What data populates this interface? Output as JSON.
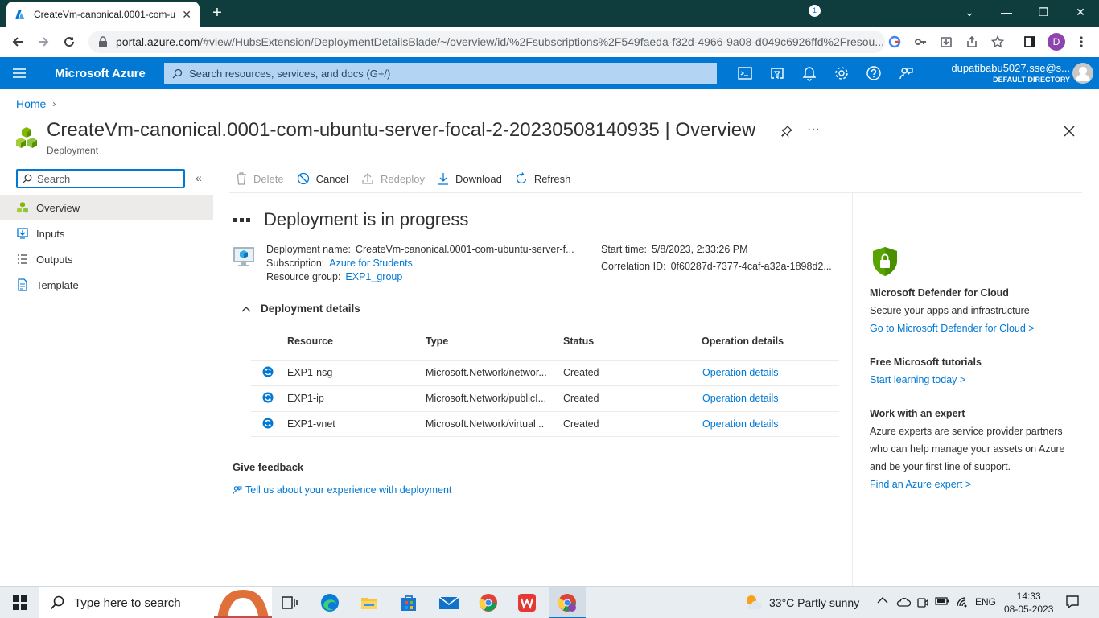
{
  "browser": {
    "tab_title": "CreateVm-canonical.0001-com-u",
    "new_tab": "+",
    "url_host": "portal.azure.com",
    "url_path": "/#view/HubsExtension/DeploymentDetailsBlade/~/overview/id/%2Fsubscriptions%2F549faeda-f32d-4966-9a08-d049c6926ffd%2Fresou...",
    "profile_initial": "D"
  },
  "azure": {
    "brand": "Microsoft Azure",
    "search_placeholder": "Search resources, services, and docs (G+/)",
    "notification_count": "1",
    "account_user": "dupatibabu5027.sse@s...",
    "account_directory": "DEFAULT DIRECTORY"
  },
  "breadcrumb": {
    "home": "Home"
  },
  "blade": {
    "title": "CreateVm-canonical.0001-com-ubuntu-server-focal-2-20230508140935",
    "title_suffix": " | Overview",
    "subtitle": "Deployment"
  },
  "menu": {
    "search_placeholder": "Search",
    "items": [
      {
        "label": "Overview"
      },
      {
        "label": "Inputs"
      },
      {
        "label": "Outputs"
      },
      {
        "label": "Template"
      }
    ]
  },
  "commands": {
    "delete": "Delete",
    "cancel": "Cancel",
    "redeploy": "Redeploy",
    "download": "Download",
    "refresh": "Refresh"
  },
  "status": {
    "title": "Deployment is in progress"
  },
  "info": {
    "deployment_name_label": "Deployment name:",
    "deployment_name": "CreateVm-canonical.0001-com-ubuntu-server-f...",
    "subscription_label": "Subscription:",
    "subscription": "Azure for Students",
    "resource_group_label": "Resource group:",
    "resource_group": "EXP1_group",
    "start_time_label": "Start time:",
    "start_time": "5/8/2023, 2:33:26 PM",
    "correlation_label": "Correlation ID:",
    "correlation_id": "0f60287d-7377-4caf-a32a-1898d2..."
  },
  "details": {
    "heading": "Deployment details",
    "columns": [
      "Resource",
      "Type",
      "Status",
      "Operation details"
    ],
    "rows": [
      {
        "resource": "EXP1-nsg",
        "type": "Microsoft.Network/networ...",
        "status": "Created",
        "op": "Operation details"
      },
      {
        "resource": "EXP1-ip",
        "type": "Microsoft.Network/publicI...",
        "status": "Created",
        "op": "Operation details"
      },
      {
        "resource": "EXP1-vnet",
        "type": "Microsoft.Network/virtual...",
        "status": "Created",
        "op": "Operation details"
      }
    ]
  },
  "feedback": {
    "heading": "Give feedback",
    "link": "Tell us about your experience with deployment"
  },
  "side": {
    "defender_title": "Microsoft Defender for Cloud",
    "defender_desc": "Secure your apps and infrastructure",
    "defender_link": "Go to Microsoft Defender for Cloud >",
    "tutorials_title": "Free Microsoft tutorials",
    "tutorials_link": "Start learning today >",
    "expert_title": "Work with an expert",
    "expert_desc": "Azure experts are service provider partners who can help manage your assets on Azure and be your first line of support.",
    "expert_link": "Find an Azure expert >"
  },
  "taskbar": {
    "search_placeholder": "Type here to search",
    "weather": "33°C  Partly sunny",
    "language": "ENG",
    "time": "14:33",
    "date": "08-05-2023"
  },
  "colors": {
    "azure_blue": "#0078d4",
    "tab_strip": "#0f3d3e",
    "link": "#0078d4"
  }
}
